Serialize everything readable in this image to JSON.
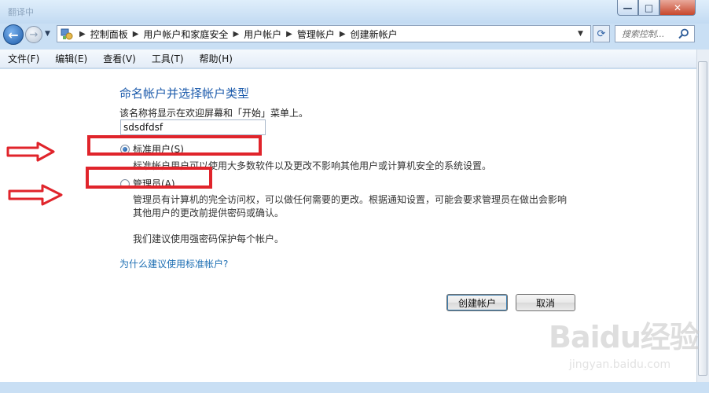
{
  "window": {
    "title_ghost": "翻译中",
    "min_glyph": "—",
    "max_glyph": "□",
    "close_glyph": "✕"
  },
  "nav": {
    "back_glyph": "←",
    "forward_glyph": "→",
    "breadcrumbs": [
      "控制面板",
      "用户帐户和家庭安全",
      "用户帐户",
      "管理帐户",
      "创建新帐户"
    ],
    "search_placeholder": "搜索控制..."
  },
  "menubar": {
    "items": [
      "文件(F)",
      "编辑(E)",
      "查看(V)",
      "工具(T)",
      "帮助(H)"
    ]
  },
  "form": {
    "heading": "命名帐户并选择帐户类型",
    "description": "该名称将显示在欢迎屏幕和「开始」菜单上。",
    "name_value": "sdsdfdsf",
    "standard": {
      "label": "标准用户(S)",
      "desc": "标准帐户用户可以使用大多数软件以及更改不影响其他用户或计算机安全的系统设置。",
      "selected": true
    },
    "admin": {
      "label": "管理员(A)",
      "desc_line1": "管理员有计算机的完全访问权，可以做任何需要的更改。根据通知设置，可能会要求管理员在做出会影响",
      "desc_line2": "其他用户的更改前提供密码或确认。",
      "selected": false
    },
    "recommend": "我们建议使用强密码保护每个帐户。",
    "why_link": "为什么建议使用标准帐户?",
    "create_button": "创建帐户",
    "cancel_button": "取消"
  },
  "watermark": {
    "logo": "Baidu经验",
    "url": "jingyan.baidu.com"
  },
  "colors": {
    "heading": "#1e5cac",
    "link": "#1e6fb3",
    "annotation_red": "#e0242b"
  }
}
